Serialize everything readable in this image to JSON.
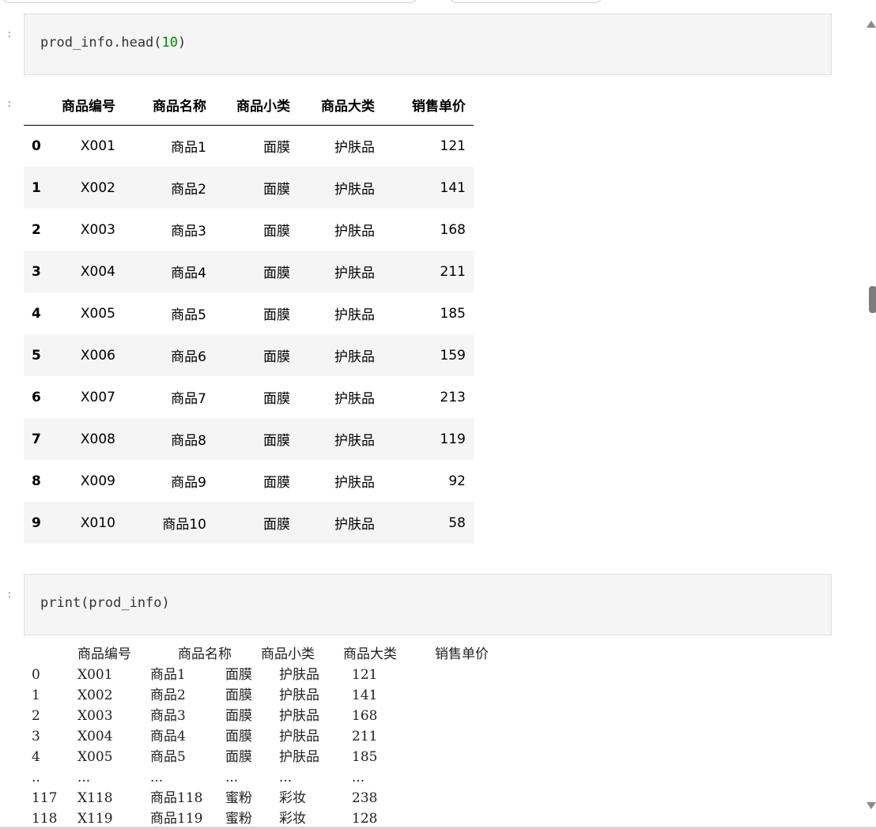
{
  "cells": [
    {
      "prompt": ":",
      "code_prefix": "prod_info.head(",
      "code_number": "10",
      "code_suffix": ")"
    },
    {
      "prompt": ":",
      "code_prefix": "print(prod_info)",
      "code_number": "",
      "code_suffix": ""
    }
  ],
  "output_prompt": ":",
  "dataframe": {
    "columns": [
      "商品编号",
      "商品名称",
      "商品小类",
      "商品大类",
      "销售单价"
    ],
    "rows": [
      {
        "index": "0",
        "cells": [
          "X001",
          "商品1",
          "面膜",
          "护肤品",
          "121"
        ]
      },
      {
        "index": "1",
        "cells": [
          "X002",
          "商品2",
          "面膜",
          "护肤品",
          "141"
        ]
      },
      {
        "index": "2",
        "cells": [
          "X003",
          "商品3",
          "面膜",
          "护肤品",
          "168"
        ]
      },
      {
        "index": "3",
        "cells": [
          "X004",
          "商品4",
          "面膜",
          "护肤品",
          "211"
        ]
      },
      {
        "index": "4",
        "cells": [
          "X005",
          "商品5",
          "面膜",
          "护肤品",
          "185"
        ]
      },
      {
        "index": "5",
        "cells": [
          "X006",
          "商品6",
          "面膜",
          "护肤品",
          "159"
        ]
      },
      {
        "index": "6",
        "cells": [
          "X007",
          "商品7",
          "面膜",
          "护肤品",
          "213"
        ]
      },
      {
        "index": "7",
        "cells": [
          "X008",
          "商品8",
          "面膜",
          "护肤品",
          "119"
        ]
      },
      {
        "index": "8",
        "cells": [
          "X009",
          "商品9",
          "面膜",
          "护肤品",
          "92"
        ]
      },
      {
        "index": "9",
        "cells": [
          "X010",
          "商品10",
          "面膜",
          "护肤品",
          "58"
        ]
      }
    ]
  },
  "print_output": {
    "header": [
      "商品编号",
      "商品名称",
      "商品小类",
      "商品大类",
      "销售单价"
    ],
    "rows": [
      [
        "0",
        "X001",
        "商品1",
        "面膜",
        "护肤品",
        "121"
      ],
      [
        "1",
        "X002",
        "商品2",
        "面膜",
        "护肤品",
        "141"
      ],
      [
        "2",
        "X003",
        "商品3",
        "面膜",
        "护肤品",
        "168"
      ],
      [
        "3",
        "X004",
        "商品4",
        "面膜",
        "护肤品",
        "211"
      ],
      [
        "4",
        "X005",
        "商品5",
        "面膜",
        "护肤品",
        "185"
      ],
      [
        "..",
        "...",
        "...",
        "...",
        "...",
        "..."
      ],
      [
        "117",
        "X118",
        "商品118",
        "蜜粉",
        "彩妆",
        "238"
      ],
      [
        "118",
        "X119",
        "商品119",
        "蜜粉",
        "彩妆",
        "128"
      ]
    ]
  }
}
